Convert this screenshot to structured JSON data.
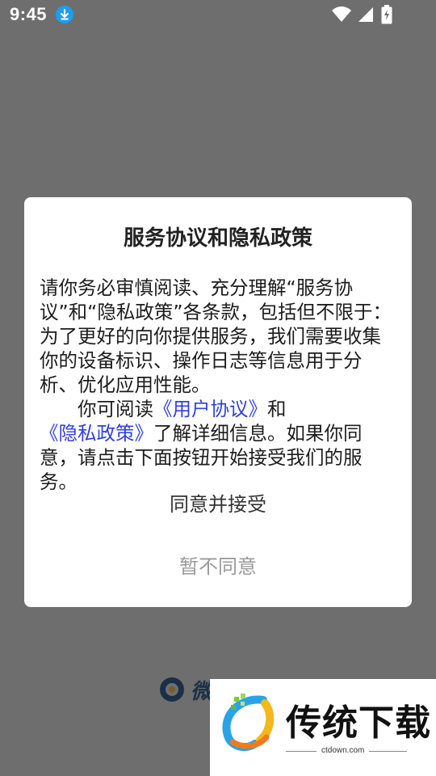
{
  "status_bar": {
    "time": "9:45",
    "download_icon": "download-icon",
    "icons": [
      "wifi-icon",
      "signal-icon",
      "battery-charging-icon"
    ],
    "download_badge_color": "#1e9ef0"
  },
  "background_logo": {
    "text": "微"
  },
  "dialog": {
    "title": "服务协议和隐私政策",
    "paragraph1": "请你务必审慎阅读、充分理解“服务协议”和“隐私政策”各条款，包括但不限于：为了更好的向你提供服务，我们需要收集你的设备标识、操作日志等信息用于分析、优化应用性能。",
    "paragraph2_prefix": "你可阅读",
    "user_agreement_link": "《用户协议》",
    "paragraph2_and": "和",
    "privacy_policy_link": "《隐私政策》",
    "paragraph2_suffix": "了解详细信息。如果你同意，请点击下面按钮开始接受我们的服务。",
    "agree_button": "同意并接受",
    "disagree_button": "暂不同意",
    "link_color": "#2f3fe0"
  },
  "watermark": {
    "name": "传统下载",
    "url": "ctdown.com"
  }
}
